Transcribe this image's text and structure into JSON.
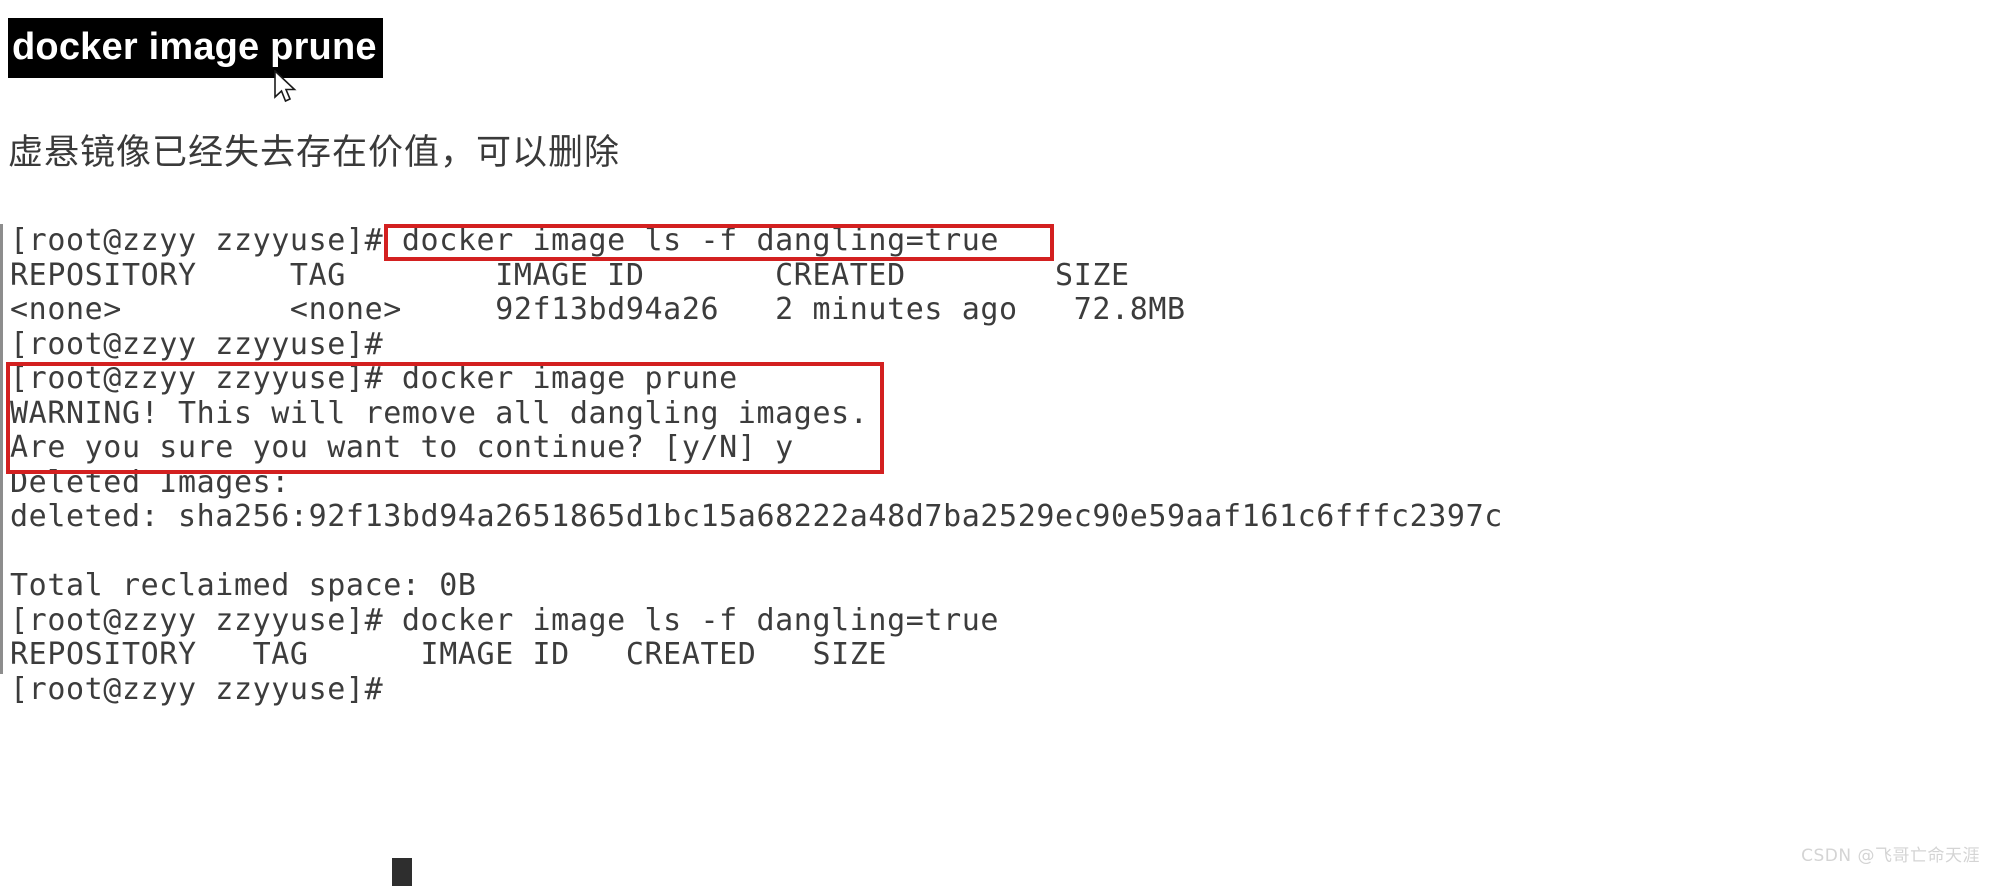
{
  "heading": {
    "text": "docker image prune",
    "selected": true,
    "selection_bg": "#000000",
    "selection_fg": "#ffffff"
  },
  "cursor": {
    "icon": "mouse-pointer-icon"
  },
  "caption": {
    "text": "虚悬镜像已经失去存在价值，可以删除"
  },
  "terminal": {
    "prompt": "[root@zzyy zzyyuse]#",
    "text_color": "#3c3c3c",
    "background": "#ffffff",
    "lines": [
      "[root@zzyy zzyyuse]# docker image ls -f dangling=true",
      "REPOSITORY     TAG        IMAGE ID       CREATED        SIZE",
      "<none>         <none>     92f13bd94a26   2 minutes ago   72.8MB",
      "[root@zzyy zzyyuse]#",
      "[root@zzyy zzyyuse]# docker image prune",
      "WARNING! This will remove all dangling images.",
      "Are you sure you want to continue? [y/N] y",
      "Deleted Images:",
      "deleted: sha256:92f13bd94a2651865d1bc15a68222a48d7ba2529ec90e59aaf161c6fffc2397c",
      "",
      "Total reclaimed space: 0B",
      "[root@zzyy zzyyuse]# docker image ls -f dangling=true",
      "REPOSITORY   TAG      IMAGE ID   CREATED   SIZE",
      "[root@zzyy zzyyuse]#"
    ],
    "commands": {
      "list_dangling": "docker image ls -f dangling=true",
      "prune": "docker image prune"
    },
    "image_table": {
      "headers": [
        "REPOSITORY",
        "TAG",
        "IMAGE ID",
        "CREATED",
        "SIZE"
      ],
      "rows": [
        [
          "<none>",
          "<none>",
          "92f13bd94a26",
          "2 minutes ago",
          "72.8MB"
        ]
      ],
      "empty_after_prune": true
    },
    "prune_output": {
      "warning": "WARNING! This will remove all dangling images.",
      "confirm_question": "Are you sure you want to continue? [y/N]",
      "confirm_answer": "y",
      "deleted_images_label": "Deleted Images:",
      "deleted_digest_prefix": "deleted: sha256:",
      "deleted_digest": "92f13bd94a2651865d1bc15a68222a48d7ba2529ec90e59aaf161c6fffc2397c",
      "total_reclaimed_label": "Total reclaimed space:",
      "total_reclaimed_value": "0B"
    }
  },
  "annotations": {
    "color": "#d32020",
    "boxes": [
      {
        "name": "ls-dangling-command",
        "label": "docker image ls -f dangling=true"
      },
      {
        "name": "prune-confirm-block",
        "label": "docker image prune / WARNING / Are you sure"
      }
    ]
  },
  "watermark": {
    "text": "CSDN @飞哥亡命天涯",
    "color": "#d4d4d4"
  }
}
